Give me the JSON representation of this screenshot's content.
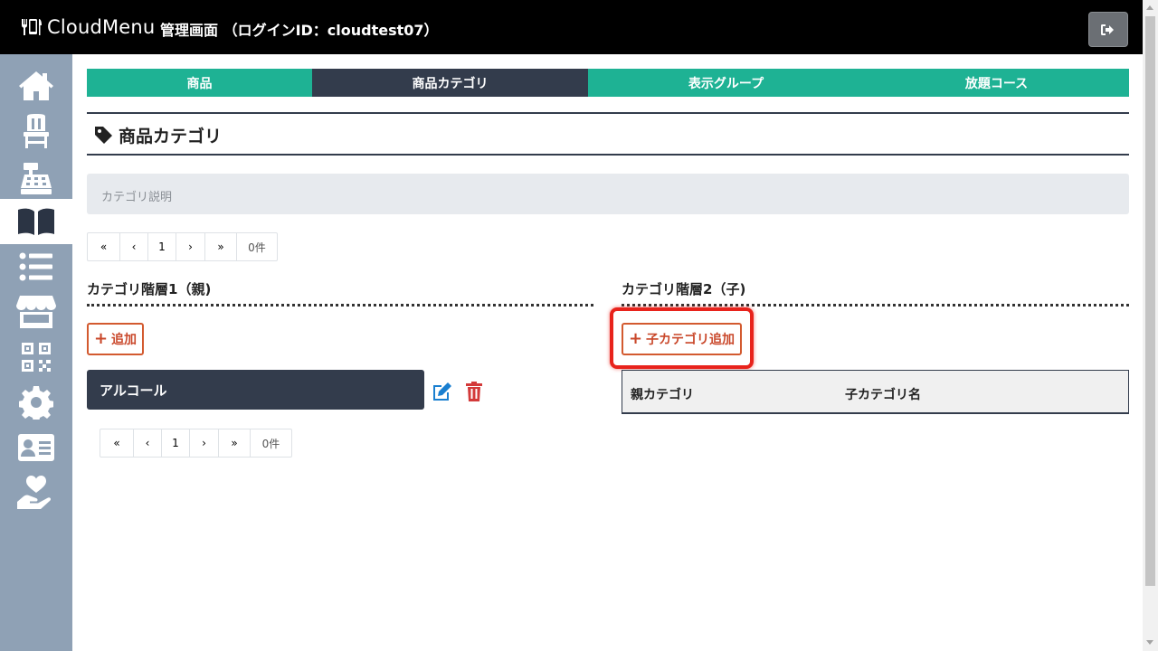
{
  "header": {
    "logo_text": "CloudMenu",
    "title": "管理画面 （ログインID：cloudtest07）",
    "logout_icon": "logout-icon"
  },
  "sidebar": {
    "items": [
      {
        "icon": "home-icon",
        "active": false
      },
      {
        "icon": "chair-icon",
        "active": false
      },
      {
        "icon": "cash-register-icon",
        "active": false
      },
      {
        "icon": "book-icon",
        "active": true
      },
      {
        "icon": "list-icon",
        "active": false
      },
      {
        "icon": "store-icon",
        "active": false
      },
      {
        "icon": "qrcode-icon",
        "active": false
      },
      {
        "icon": "gear-icon",
        "active": false
      },
      {
        "icon": "id-card-icon",
        "active": false
      },
      {
        "icon": "hand-heart-icon",
        "active": false
      }
    ]
  },
  "tabs": [
    {
      "label": "商品",
      "active": false
    },
    {
      "label": "商品カテゴリ",
      "active": true
    },
    {
      "label": "表示グループ",
      "active": false
    },
    {
      "label": "放題コース",
      "active": false
    }
  ],
  "page": {
    "title": "商品カテゴリ",
    "title_icon": "tag-icon",
    "description": "カテゴリ説明"
  },
  "pager_top": {
    "first": "«",
    "prev": "‹",
    "page": "1",
    "next": "›",
    "last": "»",
    "count": "0件"
  },
  "pager_bottom": {
    "first": "«",
    "prev": "‹",
    "page": "1",
    "next": "›",
    "last": "»",
    "count": "0件"
  },
  "level1": {
    "title": "カテゴリ階層1（親)",
    "add_label": "追加",
    "items": [
      {
        "name": "アルコール"
      }
    ]
  },
  "level2": {
    "title": "カテゴリ階層2（子)",
    "add_label": "子カテゴリ追加",
    "columns": [
      "親カテゴリ",
      "子カテゴリ名"
    ]
  },
  "colors": {
    "accent_teal": "#1eb294",
    "dark_navy": "#333c4c",
    "sidebar": "#8fa1b5",
    "danger": "#d33a3a",
    "edit_blue": "#1a7fd0",
    "highlight_red": "#e8231c"
  }
}
